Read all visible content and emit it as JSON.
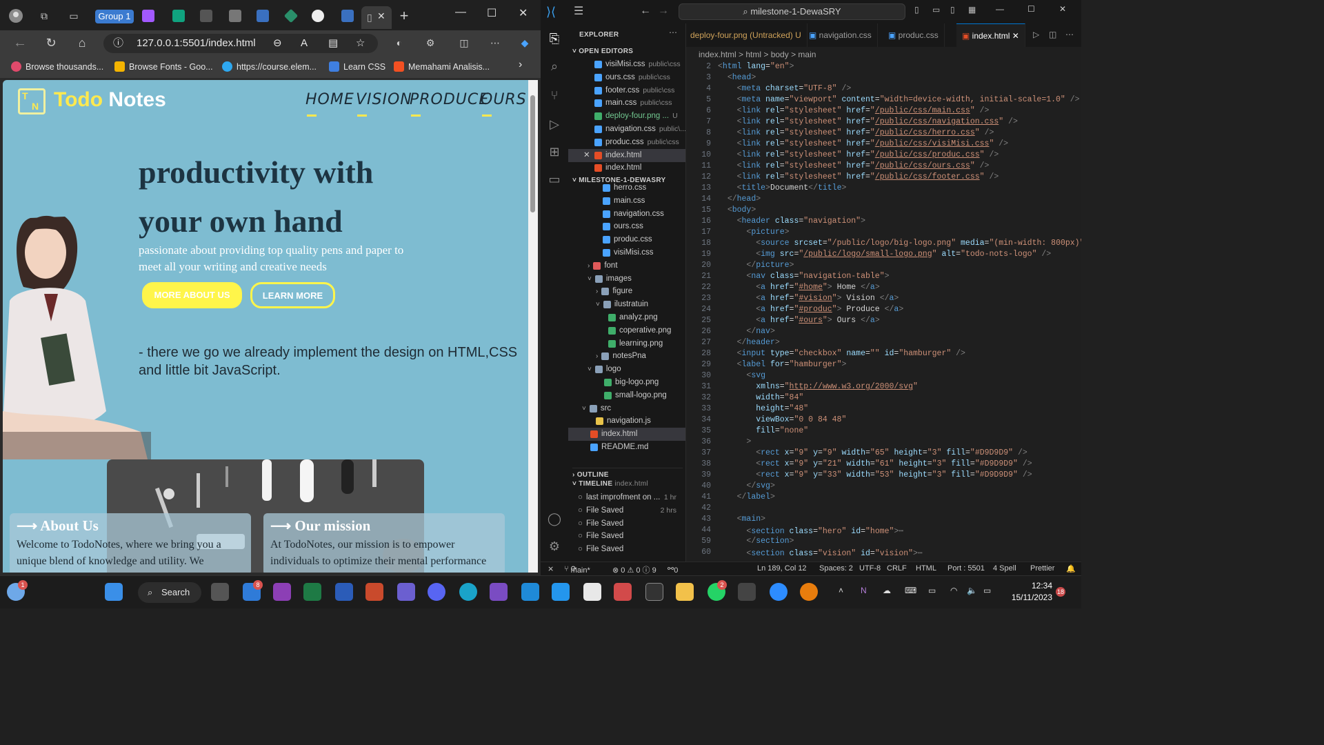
{
  "browser": {
    "group_label": "Group 1",
    "url": "127.0.0.1:5501/index.html",
    "bookmarks": [
      "Browse thousands...",
      "Browse Fonts - Goo...",
      "https://course.elem...",
      "Learn CSS",
      "Memahami Analisis..."
    ]
  },
  "site": {
    "logo_letters": "T N",
    "brand_first": "Todo",
    "brand_second": " Notes",
    "nav": [
      "HOME",
      "VISION",
      "PRODUCE",
      "OURS"
    ],
    "hero_title_line1": "productivity with",
    "hero_title_line2": "your own hand",
    "hero_sub": "passionate about providing top quality pens and paper to meet all your writing and creative needs",
    "btn_primary": "MORE ABOUT US",
    "btn_secondary": "LEARN MORE",
    "note": "- there we go we already implement the design on HTML,CSS and little bit JavaScript.",
    "about_title": "⟶ About Us",
    "about_body": "Welcome to TodoNotes, where we bring you a unique blend of knowledge and utility. We",
    "mission_title": "⟶ Our mission",
    "mission_body": "At TodoNotes, our mission is to empower individuals to optimize their mental performance"
  },
  "vscode": {
    "search": "milestone-1-DewaSRY",
    "explorer_label": "EXPLORER",
    "open_editors_label": "OPEN EDITORS",
    "open_editors": [
      {
        "name": "visiMisi.css",
        "path": "public\\css"
      },
      {
        "name": "ours.css",
        "path": "public\\css"
      },
      {
        "name": "footer.css",
        "path": "public\\css"
      },
      {
        "name": "main.css",
        "path": "public\\css"
      },
      {
        "name": "deploy-four.png ...",
        "path": "U"
      },
      {
        "name": "navigation.css",
        "path": "public\\..."
      },
      {
        "name": "produc.css",
        "path": "public\\css"
      },
      {
        "name": "index.html",
        "path": ""
      },
      {
        "name": "index.html",
        "path": ""
      }
    ],
    "project_label": "MILESTONE-1-DEWASRY",
    "tree": [
      "herro.css",
      "main.css",
      "navigation.css",
      "ours.css",
      "produc.css",
      "visiMisi.css",
      "font",
      "images",
      "figure",
      "ilustratuin",
      "analyz.png",
      "coperative.png",
      "learning.png",
      "notesPna",
      "logo",
      "big-logo.png",
      "small-logo.png",
      "src",
      "navigation.js",
      "index.html",
      "README.md"
    ],
    "outline_label": "OUTLINE",
    "timeline_label": "TIMELINE",
    "timeline_file": "index.html",
    "timeline": [
      {
        "label": "last improfment on ...",
        "time": "1 hr"
      },
      {
        "label": "File Saved",
        "time": "2 hrs"
      },
      {
        "label": "File Saved",
        "time": ""
      },
      {
        "label": "File Saved",
        "time": ""
      },
      {
        "label": "File Saved",
        "time": ""
      }
    ],
    "tabs": [
      "deploy-four.png (Untracked)",
      "U",
      "navigation.css",
      "produc.css",
      "index.html"
    ],
    "breadcrumbs": "index.html > html > body > main",
    "line_numbers": [
      "2",
      "3",
      "4",
      "5",
      "6",
      "7",
      "8",
      "9",
      "10",
      "11",
      "12",
      "13",
      "14",
      "15",
      "16",
      "17",
      "18",
      "19",
      "20",
      "21",
      "22",
      "23",
      "24",
      "25",
      "26",
      "27",
      "28",
      "29",
      "30",
      "31",
      "32",
      "33",
      "34",
      "35",
      "36",
      "37",
      "38",
      "39",
      "40",
      "41",
      "42",
      "43",
      "44",
      "59",
      "60"
    ],
    "status": [
      "main*",
      "⊗ 0 ⚠ 0 ⓘ 9",
      "0",
      "Ln 189, Col 12",
      "Spaces: 2",
      "UTF-8",
      "CRLF",
      "HTML",
      "Port : 5501",
      "4 Spell",
      "Prettier"
    ]
  },
  "taskbar": {
    "search": "Search",
    "time": "12:34",
    "date": "15/11/2023",
    "badges": [
      "1",
      "8",
      "2",
      "18"
    ]
  }
}
